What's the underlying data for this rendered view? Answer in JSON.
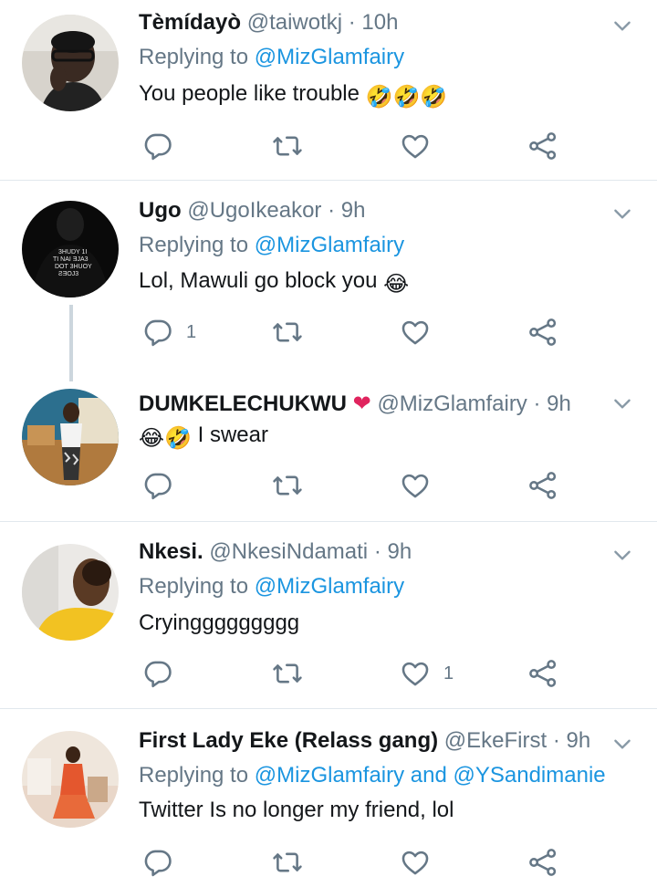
{
  "tweets": [
    {
      "name": "Tèmídayò",
      "handle": "@taiwotkj",
      "time": "· 10h",
      "reply_prefix": "Replying to",
      "reply_to": "@MizGlamfairy",
      "text": "You people like trouble",
      "text_emoji": "🤣🤣🤣",
      "reply_count": "",
      "like_count": ""
    },
    {
      "name": "Ugo",
      "handle": "@UgoIkeakor",
      "time": "· 9h",
      "reply_prefix": "Replying to",
      "reply_to": "@MizGlamfairy",
      "text": "Lol, Mawuli go block you",
      "text_emoji": "😂",
      "reply_count": "1",
      "like_count": ""
    },
    {
      "name": "DUMKELECHUKWU",
      "name_emoji": "❤",
      "handle": "@MizGlamfairy",
      "time": "· 9h",
      "text_emoji_prefix": "😂🤣",
      "text": "I swear",
      "reply_count": "",
      "like_count": ""
    },
    {
      "name": "Nkesi.",
      "handle": "@NkesiNdamati",
      "time": "· 9h",
      "reply_prefix": "Replying to",
      "reply_to": "@MizGlamfairy",
      "text": "Cryinggggggggg",
      "reply_count": "",
      "like_count": "1"
    },
    {
      "name": "First Lady Eke (Relass gang)",
      "handle": "@EkeFirst",
      "time": "· 9h",
      "reply_prefix": "Replying to",
      "reply_to": "@MizGlamfairy and @YSandimanie",
      "text": "Twitter Is no longer my friend,  lol",
      "reply_count": "",
      "like_count": ""
    }
  ],
  "colors": {
    "link": "#1b95e0",
    "secondary": "#657786",
    "divider": "#e1e8ed",
    "thread_line": "#ccd6dd"
  },
  "icons": [
    "reply-icon",
    "retweet-icon",
    "like-icon",
    "share-icon",
    "chevron-down-icon"
  ]
}
